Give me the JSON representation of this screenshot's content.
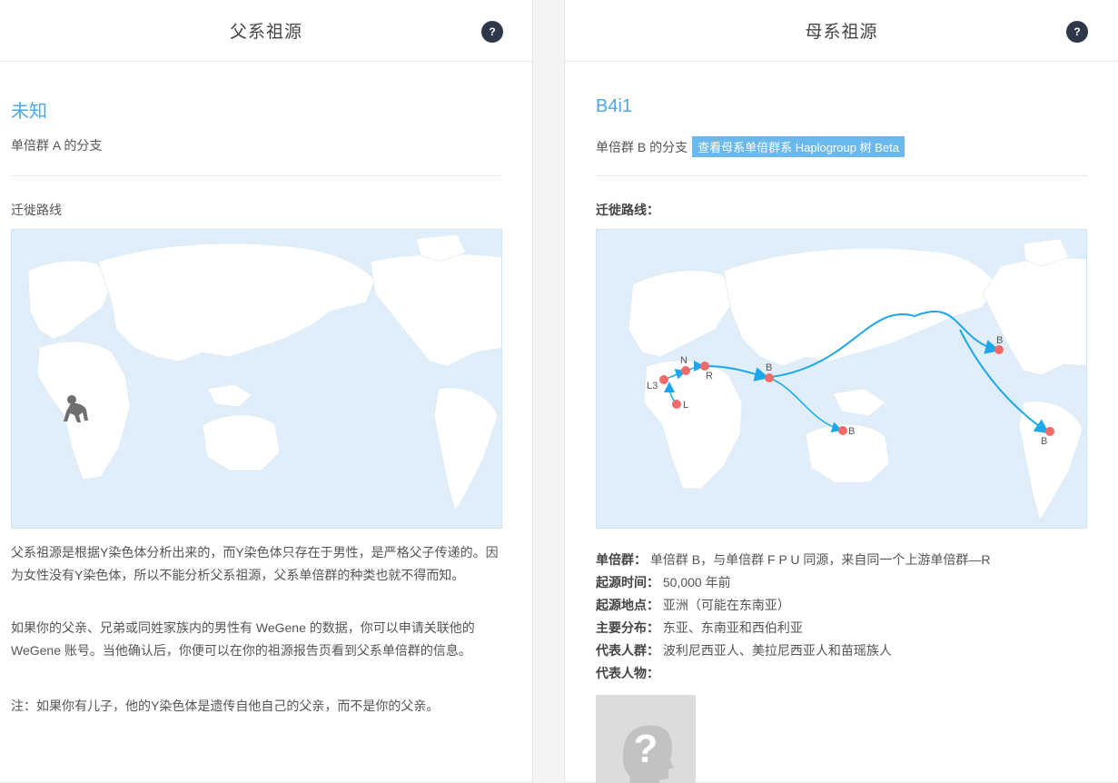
{
  "paternal": {
    "title": "父系祖源",
    "help": "?",
    "haplogroup": "未知",
    "branch": "单倍群 A 的分支",
    "route_label": "迁徙路线",
    "paragraphs": [
      "父系祖源是根据Y染色体分析出来的，而Y染色体只存在于男性，是严格父子传递的。因为女性没有Y染色体，所以不能分析父系祖源，父系单倍群的种类也就不得而知。",
      "如果你的父亲、兄弟或同姓家族内的男性有 WeGene 的数据，你可以申请关联他的 WeGene 账号。当他确认后，你便可以在你的祖源报告页看到父系单倍群的信息。",
      "注：如果你有儿子，他的Y染色体是遗传自他自己的父亲，而不是你的父亲。"
    ],
    "map_icon": "ape-icon"
  },
  "maternal": {
    "title": "母系祖源",
    "help": "?",
    "haplogroup": "B4i1",
    "branch": "单倍群 B 的分支",
    "tree_link": "查看母系单倍群系 Haplogroup 树 Beta",
    "route_label": "迁徙路线：",
    "map_labels": {
      "L": "L",
      "L3": "L3",
      "N": "N",
      "R": "R",
      "B_asia": "B",
      "B_oceania": "B",
      "B_north_america": "B",
      "B_south_america": "B"
    },
    "info": [
      {
        "key": "单倍群：",
        "value": "单倍群 B，与单倍群 F P U 同源，来自同一个上游单倍群—R"
      },
      {
        "key": "起源时间：",
        "value": "50,000 年前"
      },
      {
        "key": "起源地点：",
        "value": "亚洲（可能在东南亚）"
      },
      {
        "key": "主要分布：",
        "value": "东亚、东南亚和西伯利亚"
      },
      {
        "key": "代表人群：",
        "value": "波利尼西亚人、美拉尼西亚人和苗瑶族人"
      },
      {
        "key": "代表人物：",
        "value": ""
      }
    ],
    "avatar_icon": "unknown-person-icon"
  },
  "colors": {
    "accent": "#4aa8e8",
    "ocean": "#e0eef9",
    "land": "#ffffff",
    "route": "#1aa7ec",
    "node": "#f06a6a",
    "help_bg": "#2e3848"
  }
}
